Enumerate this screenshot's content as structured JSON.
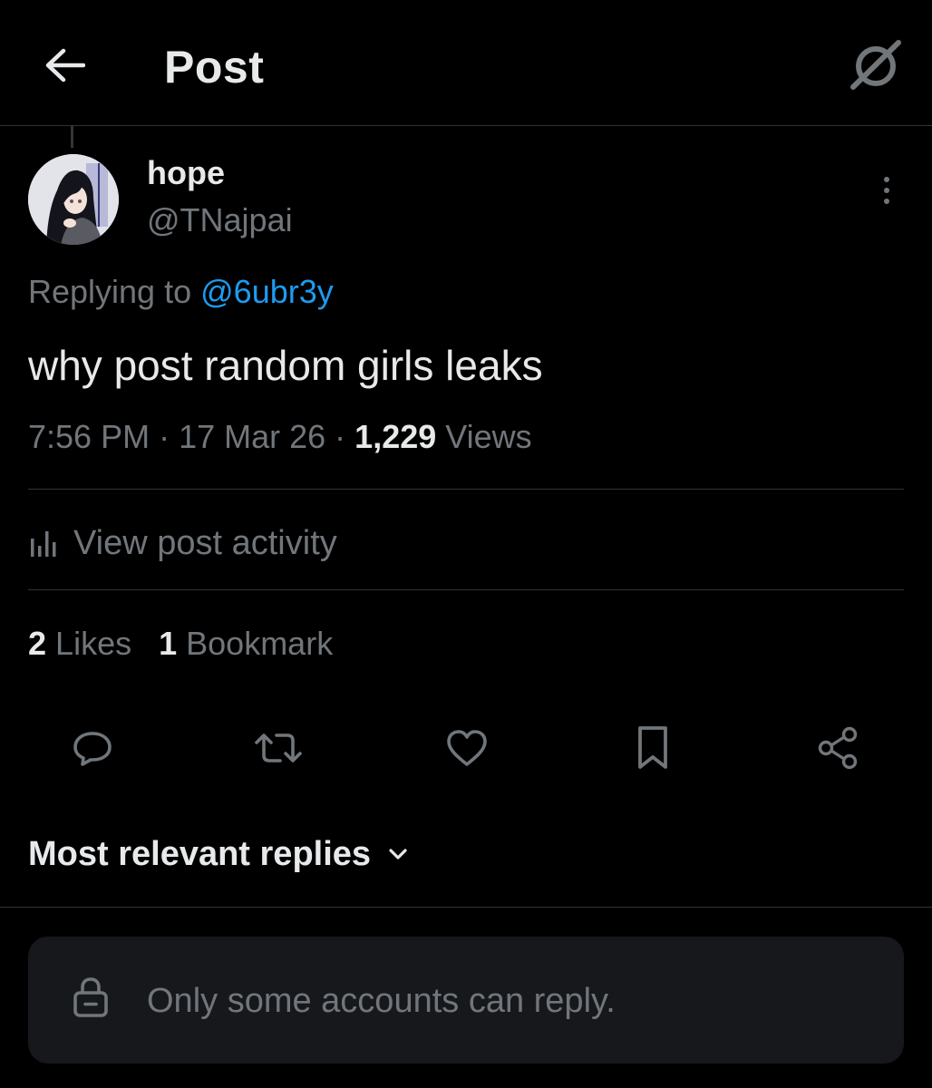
{
  "header": {
    "title": "Post",
    "back_icon": "arrow-left-icon",
    "grok_icon": "grok-icon"
  },
  "post": {
    "display_name": "hope",
    "handle": "@TNajpai",
    "replying_prefix": "Replying to",
    "replying_to": "@6ubr3y",
    "text": "why post random girls leaks",
    "time": "7:56 PM",
    "date": "17 Mar 26",
    "views_count": "1,229",
    "views_label": "Views",
    "separator": " · "
  },
  "activity": {
    "label": "View post activity",
    "icon": "bar-chart-icon"
  },
  "stats": {
    "likes_count": "2",
    "likes_label": "Likes",
    "bookmarks_count": "1",
    "bookmarks_label": "Bookmark"
  },
  "actions": [
    {
      "name": "reply",
      "icon": "speech-bubble-icon"
    },
    {
      "name": "repost",
      "icon": "repost-arrows-icon"
    },
    {
      "name": "like",
      "icon": "heart-icon"
    },
    {
      "name": "bookmark",
      "icon": "bookmark-icon"
    },
    {
      "name": "share",
      "icon": "share-icon"
    }
  ],
  "replies": {
    "sort_label": "Most relevant replies",
    "restriction_text": "Only some accounts can reply.",
    "restriction_icon": "lock-icon"
  },
  "colors": {
    "background": "#000000",
    "text_primary": "#e7e9ea",
    "text_secondary": "#71767b",
    "accent": "#1d9bf0",
    "divider": "#2f3336",
    "restriction_box": "#16181c"
  }
}
